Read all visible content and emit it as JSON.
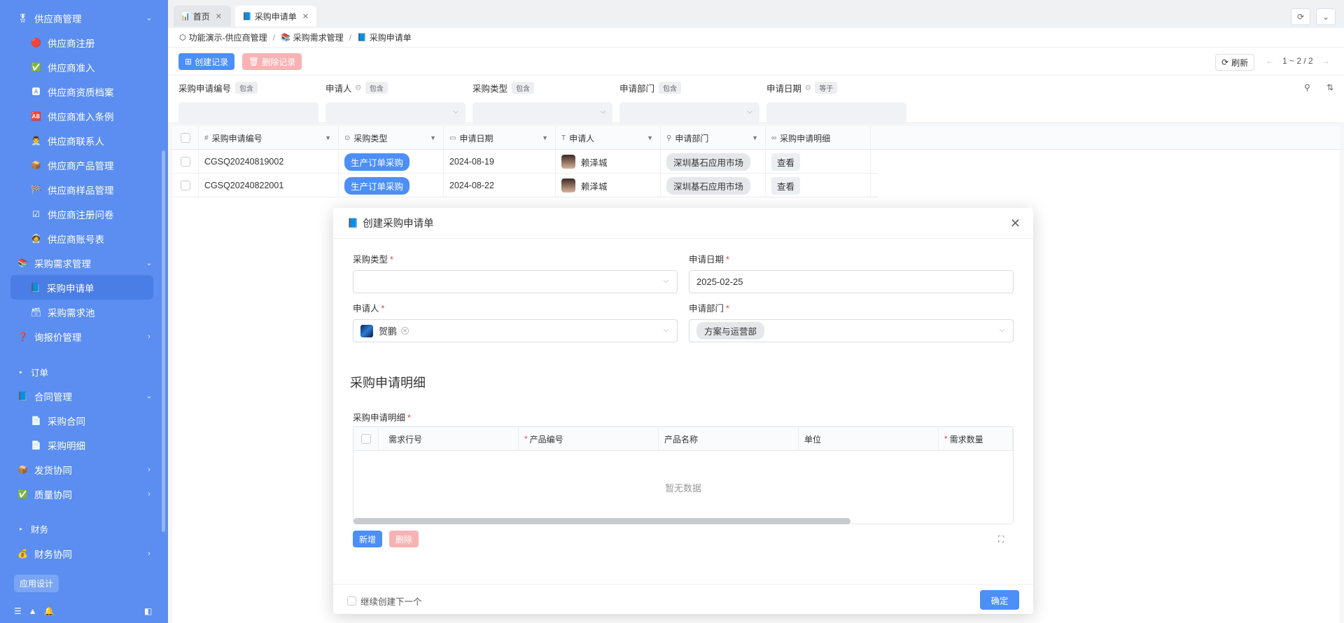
{
  "sidebar": {
    "items": [
      {
        "label": "供应商管理",
        "icon": "🎖",
        "level": "top",
        "expanded": true
      },
      {
        "label": "供应商注册",
        "icon": "🔴",
        "level": "sub"
      },
      {
        "label": "供应商准入",
        "icon": "✅",
        "level": "sub"
      },
      {
        "label": "供应商资质档案",
        "icon": "🅰",
        "level": "sub"
      },
      {
        "label": "供应商准入条例",
        "icon": "🆎",
        "level": "sub"
      },
      {
        "label": "供应商联系人",
        "icon": "👨‍💼",
        "level": "sub"
      },
      {
        "label": "供应商产品管理",
        "icon": "📦",
        "level": "sub"
      },
      {
        "label": "供应商样品管理",
        "icon": "🏁",
        "level": "sub"
      },
      {
        "label": "供应商注册问卷",
        "icon": "☑",
        "level": "sub"
      },
      {
        "label": "供应商账号表",
        "icon": "🧑‍🚀",
        "level": "sub"
      },
      {
        "label": "采购需求管理",
        "icon": "📚",
        "level": "top",
        "expanded": true
      },
      {
        "label": "采购申请单",
        "icon": "📘",
        "level": "sub",
        "active": true
      },
      {
        "label": "采购需求池",
        "icon": "🗃",
        "level": "sub"
      },
      {
        "label": "询报价管理",
        "icon": "❓",
        "level": "top",
        "expanded": false
      }
    ],
    "group_order": "订单",
    "items2": [
      {
        "label": "合同管理",
        "icon": "📘",
        "level": "top",
        "expanded": true
      },
      {
        "label": "采购合同",
        "icon": "📄",
        "level": "sub"
      },
      {
        "label": "采购明细",
        "icon": "📄",
        "level": "sub"
      },
      {
        "label": "发货协同",
        "icon": "📦",
        "level": "top",
        "expanded": false
      },
      {
        "label": "质量协同",
        "icon": "✅",
        "level": "top",
        "expanded": false
      }
    ],
    "group_finance": "财务",
    "items3": [
      {
        "label": "财务协同",
        "icon": "💰",
        "level": "top",
        "expanded": false
      }
    ],
    "app_design": "应用设计"
  },
  "tabs": [
    {
      "label": "首页",
      "icon": "📊"
    },
    {
      "label": "采购申请单",
      "icon": "📘"
    }
  ],
  "breadcrumb": [
    "功能演示-供应商管理",
    "采购需求管理",
    "采购申请单"
  ],
  "breadcrumb_icons": [
    "⬡",
    "📚",
    "📘"
  ],
  "toolbar": {
    "create": "创建记录",
    "delete": "删除记录",
    "refresh": "刷新",
    "pager": "1 ~ 2 / 2"
  },
  "filters": [
    {
      "label": "采购申请编号",
      "op": "包含",
      "select": false
    },
    {
      "label": "申请人",
      "op": "包含",
      "select": true
    },
    {
      "label": "采购类型",
      "op": "包含",
      "select": true
    },
    {
      "label": "申请部门",
      "op": "包含",
      "select": true
    },
    {
      "label": "申请日期",
      "op": "等于",
      "select": false
    }
  ],
  "table": {
    "columns": [
      {
        "label": "采购申请编号",
        "icon": "#"
      },
      {
        "label": "采购类型",
        "icon": "⊙"
      },
      {
        "label": "申请日期",
        "icon": "▭"
      },
      {
        "label": "申请人",
        "icon": "T"
      },
      {
        "label": "申请部门",
        "icon": "⚲"
      },
      {
        "label": "采购申请明细",
        "icon": "∞"
      }
    ],
    "rows": [
      {
        "code": "CGSQ20240819002",
        "type": "生产订单采购",
        "date": "2024-08-19",
        "applicant": "赖泽城",
        "dept": "深圳基石应用市场",
        "detail": "查看"
      },
      {
        "code": "CGSQ20240822001",
        "type": "生产订单采购",
        "date": "2024-08-22",
        "applicant": "赖泽城",
        "dept": "深圳基石应用市场",
        "detail": "查看"
      }
    ]
  },
  "modal": {
    "title": "创建采购申请单",
    "fields": {
      "type_label": "采购类型",
      "date_label": "申请日期",
      "date_value": "2025-02-25",
      "applicant_label": "申请人",
      "applicant_value": "贺鹏",
      "dept_label": "申请部门",
      "dept_value": "方案与运营部"
    },
    "section_title": "采购申请明细",
    "subtable_label": "采购申请明细",
    "subtable_columns": [
      {
        "label": "需求行号",
        "required": false
      },
      {
        "label": "产品编号",
        "required": true
      },
      {
        "label": "产品名称",
        "required": false
      },
      {
        "label": "单位",
        "required": false
      },
      {
        "label": "需求数量",
        "required": true
      }
    ],
    "empty_text": "暂无数据",
    "add": "新增",
    "delete": "删除",
    "continue_label": "继续创建下一个",
    "ok": "确定"
  }
}
